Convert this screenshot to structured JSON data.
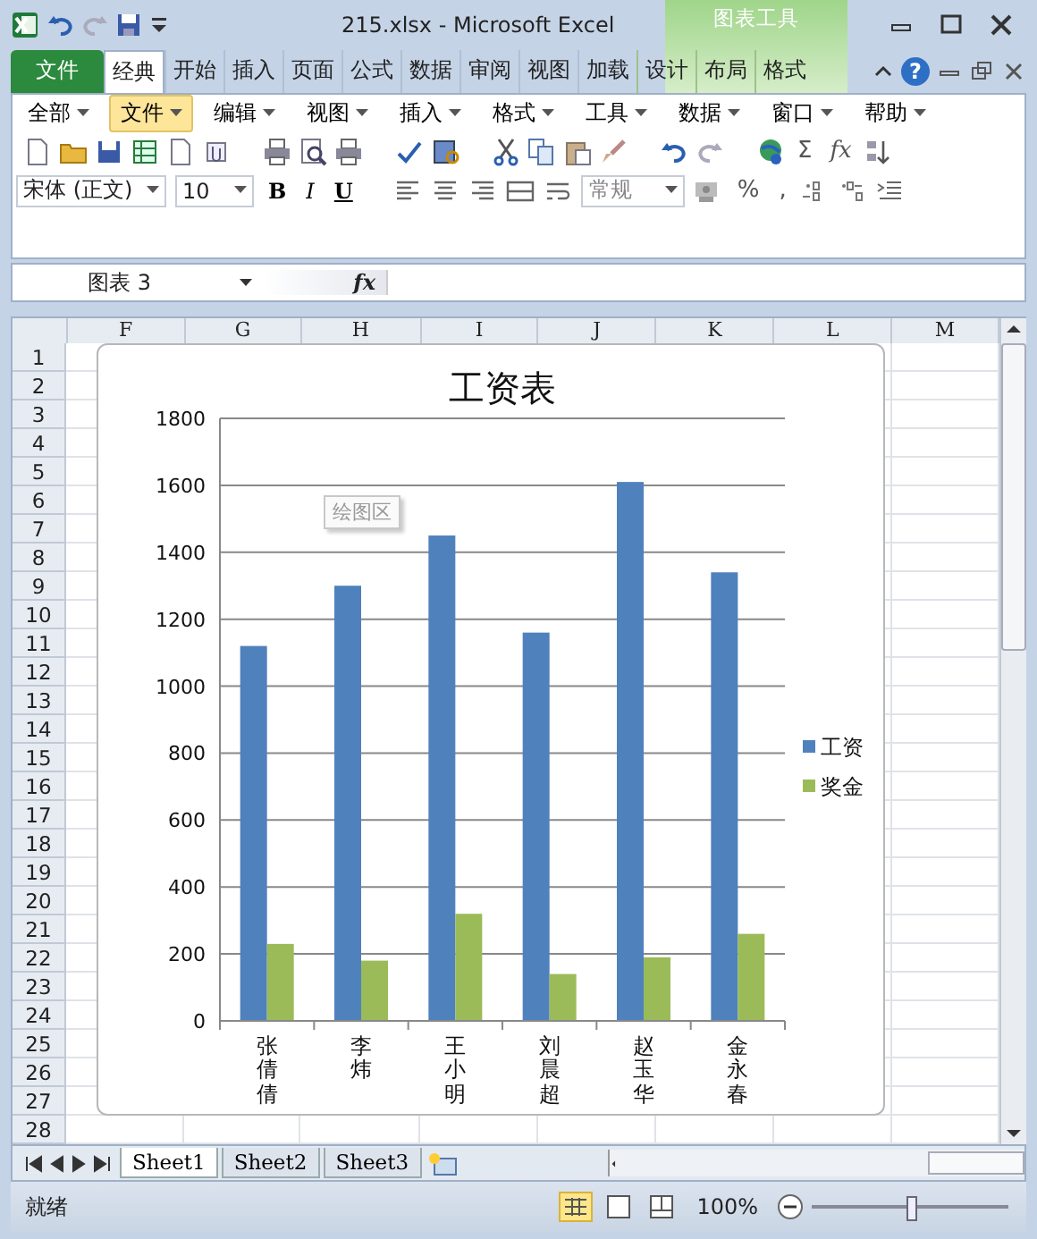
{
  "window": {
    "title": "215.xlsx  -  Microsoft Excel",
    "context_header": "图表工具"
  },
  "ribbon_tabs": [
    {
      "label": "文件",
      "kind": "file",
      "selected": false
    },
    {
      "label": "经典",
      "kind": "tab",
      "selected": true
    },
    {
      "label": "开始",
      "kind": "tab",
      "selected": false
    },
    {
      "label": "插入",
      "kind": "tab",
      "selected": false
    },
    {
      "label": "页面",
      "kind": "tab",
      "selected": false
    },
    {
      "label": "公式",
      "kind": "tab",
      "selected": false
    },
    {
      "label": "数据",
      "kind": "tab",
      "selected": false
    },
    {
      "label": "审阅",
      "kind": "tab",
      "selected": false
    },
    {
      "label": "视图",
      "kind": "tab",
      "selected": false
    },
    {
      "label": "加载",
      "kind": "tab",
      "selected": false
    },
    {
      "label": "设计",
      "kind": "context",
      "selected": false
    },
    {
      "label": "布局",
      "kind": "context",
      "selected": false
    },
    {
      "label": "格式",
      "kind": "context",
      "selected": false
    }
  ],
  "help": "?",
  "menu": [
    {
      "label": "全部",
      "selected": false
    },
    {
      "label": "文件",
      "selected": true
    },
    {
      "label": "编辑",
      "selected": false
    },
    {
      "label": "视图",
      "selected": false
    },
    {
      "label": "插入",
      "selected": false
    },
    {
      "label": "格式",
      "selected": false
    },
    {
      "label": "工具",
      "selected": false
    },
    {
      "label": "数据",
      "selected": false
    },
    {
      "label": "窗口",
      "selected": false
    },
    {
      "label": "帮助",
      "selected": false
    }
  ],
  "toolbar_symbols": [
    "Σ",
    "fx"
  ],
  "format_bar": {
    "font": "宋体 (正文)",
    "size": "10",
    "bold": "B",
    "italic": "I",
    "underline": "U",
    "number_format": "常规",
    "percent": "%",
    "comma": ","
  },
  "formula_bar": {
    "name_box": "图表 3",
    "fx": "fx"
  },
  "columns": [
    "F",
    "G",
    "H",
    "I",
    "J",
    "K",
    "L",
    "M"
  ],
  "rows": [
    "1",
    "2",
    "3",
    "4",
    "5",
    "6",
    "7",
    "8",
    "9",
    "10",
    "11",
    "12",
    "13",
    "14",
    "15",
    "16",
    "17",
    "18",
    "19",
    "20",
    "21",
    "22",
    "23",
    "24",
    "25",
    "26",
    "27",
    "28"
  ],
  "chart": {
    "tooltip": "绘图区",
    "chart_data": {
      "type": "bar",
      "title": "工资表",
      "categories": [
        "张倩倩",
        "李炜",
        "王小明",
        "刘晨超",
        "赵玉华",
        "金永春"
      ],
      "series": [
        {
          "name": "工资",
          "color": "#4f81bd",
          "values": [
            1120,
            1300,
            1450,
            1160,
            1610,
            1340
          ]
        },
        {
          "name": "奖金",
          "color": "#9bbb59",
          "values": [
            230,
            180,
            320,
            140,
            190,
            260
          ]
        }
      ],
      "ylim": [
        0,
        1800
      ],
      "grid": true,
      "legend": "right",
      "yticks": [
        0,
        200,
        400,
        600,
        800,
        1000,
        1200,
        1400,
        1600,
        1800
      ]
    }
  },
  "sheet_tabs": [
    {
      "label": "Sheet1",
      "selected": true
    },
    {
      "label": "Sheet2",
      "selected": false
    },
    {
      "label": "Sheet3",
      "selected": false
    }
  ],
  "status_bar": {
    "status": "就绪",
    "zoom": "100%",
    "zoom_slider": {
      "level": 0.5
    }
  }
}
